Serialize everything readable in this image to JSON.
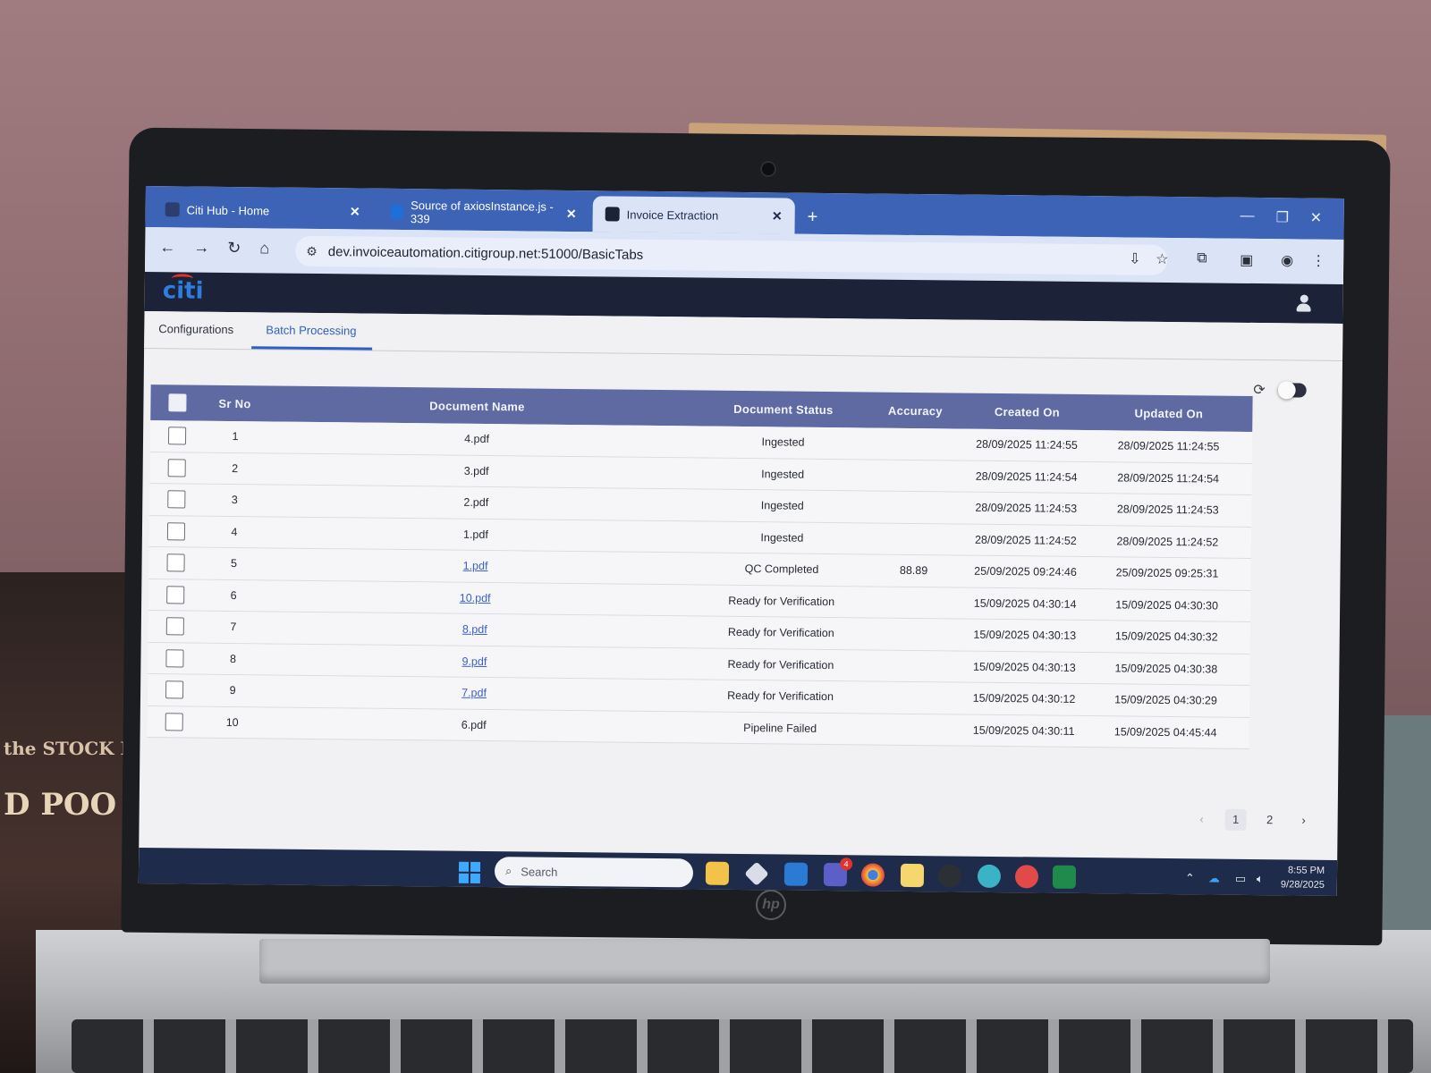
{
  "browser": {
    "tabs": [
      {
        "label": "Citi Hub - Home",
        "active": false
      },
      {
        "label": "Source of axiosInstance.js - 339",
        "active": false
      },
      {
        "label": "Invoice Extraction",
        "active": true
      }
    ],
    "url": "dev.invoiceautomation.citigroup.net:51000/BasicTabs"
  },
  "app": {
    "logo_text": "citi",
    "tabs": [
      {
        "label": "Configurations",
        "active": false
      },
      {
        "label": "Batch Processing",
        "active": true
      }
    ],
    "toggle_on": false
  },
  "table": {
    "headers": {
      "sr_no": "Sr No",
      "document_name": "Document Name",
      "document_status": "Document Status",
      "accuracy": "Accuracy",
      "created_on": "Created On",
      "updated_on": "Updated On"
    },
    "rows": [
      {
        "sr": "1",
        "doc": "4.pdf",
        "link": false,
        "status": "Ingested",
        "accuracy": "",
        "created": "28/09/2025 11:24:55",
        "updated": "28/09/2025 11:24:55"
      },
      {
        "sr": "2",
        "doc": "3.pdf",
        "link": false,
        "status": "Ingested",
        "accuracy": "",
        "created": "28/09/2025 11:24:54",
        "updated": "28/09/2025 11:24:54"
      },
      {
        "sr": "3",
        "doc": "2.pdf",
        "link": false,
        "status": "Ingested",
        "accuracy": "",
        "created": "28/09/2025 11:24:53",
        "updated": "28/09/2025 11:24:53"
      },
      {
        "sr": "4",
        "doc": "1.pdf",
        "link": false,
        "status": "Ingested",
        "accuracy": "",
        "created": "28/09/2025 11:24:52",
        "updated": "28/09/2025 11:24:52"
      },
      {
        "sr": "5",
        "doc": "1.pdf",
        "link": true,
        "status": "QC Completed",
        "accuracy": "88.89",
        "created": "25/09/2025 09:24:46",
        "updated": "25/09/2025 09:25:31"
      },
      {
        "sr": "6",
        "doc": "10.pdf",
        "link": true,
        "status": "Ready for Verification",
        "accuracy": "",
        "created": "15/09/2025 04:30:14",
        "updated": "15/09/2025 04:30:30"
      },
      {
        "sr": "7",
        "doc": "8.pdf",
        "link": true,
        "status": "Ready for Verification",
        "accuracy": "",
        "created": "15/09/2025 04:30:13",
        "updated": "15/09/2025 04:30:32"
      },
      {
        "sr": "8",
        "doc": "9.pdf",
        "link": true,
        "status": "Ready for Verification",
        "accuracy": "",
        "created": "15/09/2025 04:30:13",
        "updated": "15/09/2025 04:30:38"
      },
      {
        "sr": "9",
        "doc": "7.pdf",
        "link": true,
        "status": "Ready for Verification",
        "accuracy": "",
        "created": "15/09/2025 04:30:12",
        "updated": "15/09/2025 04:30:29"
      },
      {
        "sr": "10",
        "doc": "6.pdf",
        "link": false,
        "status": "Pipeline Failed",
        "accuracy": "",
        "created": "15/09/2025 04:30:11",
        "updated": "15/09/2025 04:45:44"
      }
    ]
  },
  "pagination": {
    "pages": [
      "1",
      "2"
    ],
    "current": "1",
    "prev_icon": "chevron-left-icon",
    "next_icon": "chevron-right-icon"
  },
  "taskbar": {
    "search_placeholder": "Search",
    "time": "8:55 PM",
    "date": "9/28/2025",
    "teams_badge": "4"
  },
  "scene": {
    "book_text_1": "the STOCK MAR",
    "book_text_2": "D POO"
  },
  "colors": {
    "browser_accent": "#3c63b6",
    "app_header": "#1c2338",
    "table_header": "#5f6aa3",
    "link": "#3a5fc8",
    "active_tab": "#2f5fbf"
  }
}
